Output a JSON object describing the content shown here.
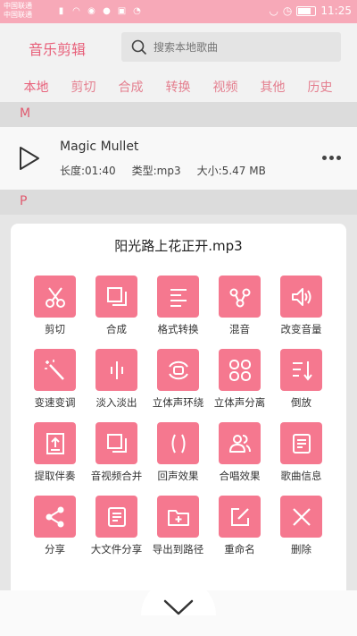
{
  "status_bar": {
    "carrier1": "中国联通",
    "carrier2": "中国联通",
    "time": "11:25"
  },
  "header": {
    "title": "音乐剪辑",
    "search_placeholder": "搜索本地歌曲"
  },
  "tabs": [
    {
      "label": "本地",
      "active": true
    },
    {
      "label": "剪切"
    },
    {
      "label": "合成"
    },
    {
      "label": "转换"
    },
    {
      "label": "视频"
    },
    {
      "label": "其他"
    },
    {
      "label": "历史"
    }
  ],
  "sections": [
    {
      "letter": "M"
    },
    {
      "letter": "P"
    }
  ],
  "song": {
    "title": "Magic Mullet",
    "duration": "长度:01:40",
    "type": "类型:mp3",
    "size": "大小:5.47 MB"
  },
  "dialog": {
    "title": "阳光路上花正开.mp3",
    "rows": [
      [
        {
          "label": "剪切",
          "icon": "scissors-icon"
        },
        {
          "label": "合成",
          "icon": "merge-icon"
        },
        {
          "label": "格式转换",
          "icon": "lines-icon"
        },
        {
          "label": "混音",
          "icon": "share-nodes-icon"
        },
        {
          "label": "改变音量",
          "icon": "volume-icon"
        }
      ],
      [
        {
          "label": "变速变调",
          "icon": "magic-wand-icon"
        },
        {
          "label": "淡入淡出",
          "icon": "fade-icon"
        },
        {
          "label": "立体声环绕",
          "icon": "surround-icon"
        },
        {
          "label": "立体声分离",
          "icon": "split-icon"
        },
        {
          "label": "倒放",
          "icon": "reverse-icon"
        }
      ],
      [
        {
          "label": "提取伴奏",
          "icon": "extract-icon"
        },
        {
          "label": "音视频合并",
          "icon": "av-merge-icon"
        },
        {
          "label": "回声效果",
          "icon": "echo-icon"
        },
        {
          "label": "合唱效果",
          "icon": "chorus-icon"
        },
        {
          "label": "歌曲信息",
          "icon": "info-doc-icon"
        }
      ],
      [
        {
          "label": "分享",
          "icon": "share-icon"
        },
        {
          "label": "大文件分享",
          "icon": "big-file-icon"
        },
        {
          "label": "导出到路径",
          "icon": "export-folder-icon"
        },
        {
          "label": "重命名",
          "icon": "rename-icon"
        },
        {
          "label": "删除",
          "icon": "delete-icon"
        }
      ]
    ]
  },
  "colors": {
    "accent": "#f5788f",
    "status_bar": "#f7a9b8",
    "title_pink": "#e8607a"
  }
}
